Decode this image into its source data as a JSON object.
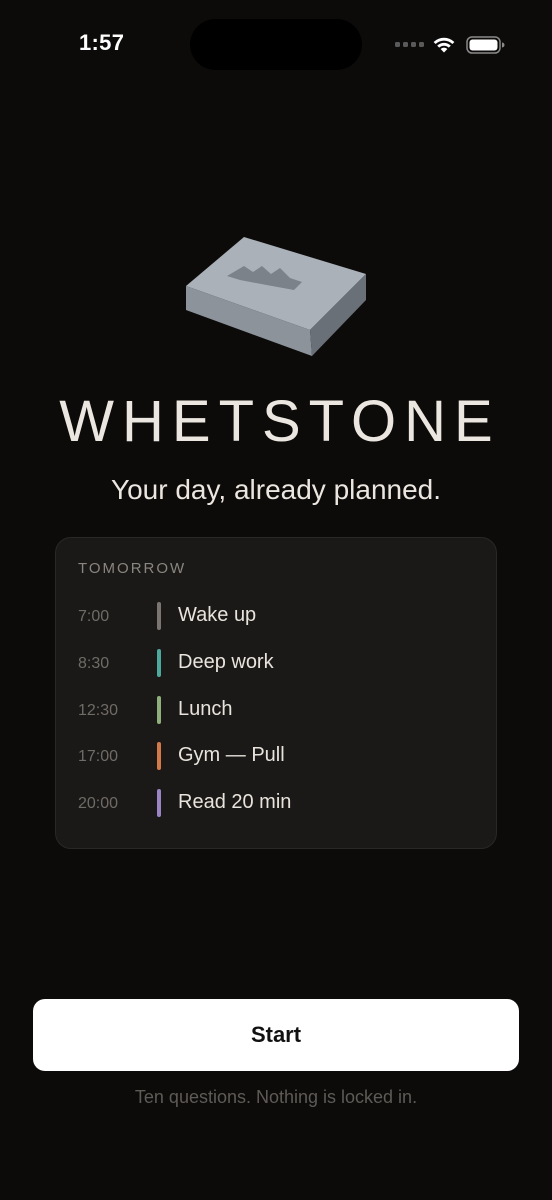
{
  "status_bar": {
    "time": "1:57",
    "signal_icon": "cellular-signal-icon",
    "wifi_icon": "wifi-icon",
    "battery_icon": "battery-icon"
  },
  "logo": {
    "icon": "whetstone-logo-icon"
  },
  "brand": "WHETSTONE",
  "tagline": "Your day, already planned.",
  "preview": {
    "heading": "TOMORROW",
    "items": [
      {
        "time": "7:00",
        "label": "Wake up",
        "color": "#7a7570"
      },
      {
        "time": "8:30",
        "label": "Deep work",
        "color": "#4fa89e"
      },
      {
        "time": "12:30",
        "label": "Lunch",
        "color": "#8fb07c"
      },
      {
        "time": "17:00",
        "label": "Gym — Pull",
        "color": "#d27a4a"
      },
      {
        "time": "20:00",
        "label": "Read 20 min",
        "color": "#9a84c4"
      }
    ]
  },
  "start_button": {
    "label": "Start"
  },
  "footnote": "Ten questions. Nothing is locked in."
}
